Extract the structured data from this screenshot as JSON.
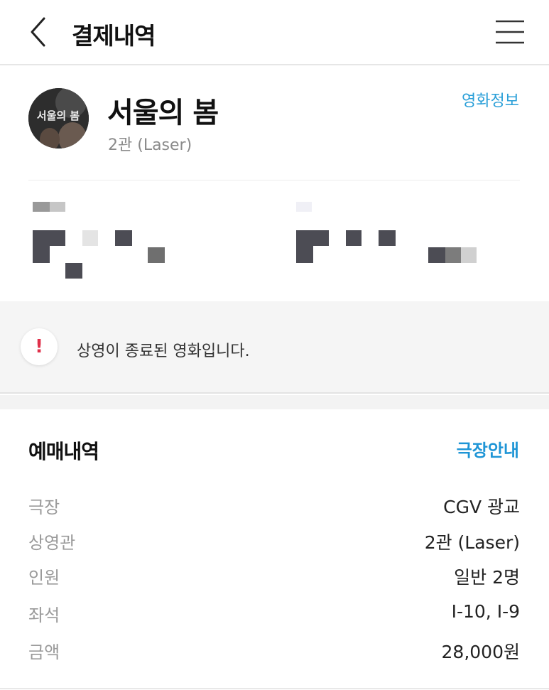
{
  "header": {
    "title": "결제내역",
    "back_icon": "chevron-left-icon",
    "menu_icon": "hamburger-menu-icon"
  },
  "movie": {
    "title": "서울의 봄",
    "poster_text": "서울의 봄",
    "hall": "2관 (Laser)",
    "info_link": "영화정보"
  },
  "notice": {
    "icon": "!",
    "text": "상영이 종료된 영화입니다."
  },
  "booking": {
    "title": "예매내역",
    "theater_link": "극장안내",
    "rows": [
      {
        "label": "극장",
        "value": "CGV 광교"
      },
      {
        "label": "상영관",
        "value": "2관 (Laser)"
      },
      {
        "label": "인원",
        "value": "일반 2명"
      },
      {
        "label": "좌석",
        "value": "I-10, I-9"
      },
      {
        "label": "금액",
        "value": "28,000원"
      }
    ]
  },
  "colors": {
    "accent": "#2a9fd8",
    "alert": "#e0304a",
    "muted": "#9a9a9a"
  }
}
